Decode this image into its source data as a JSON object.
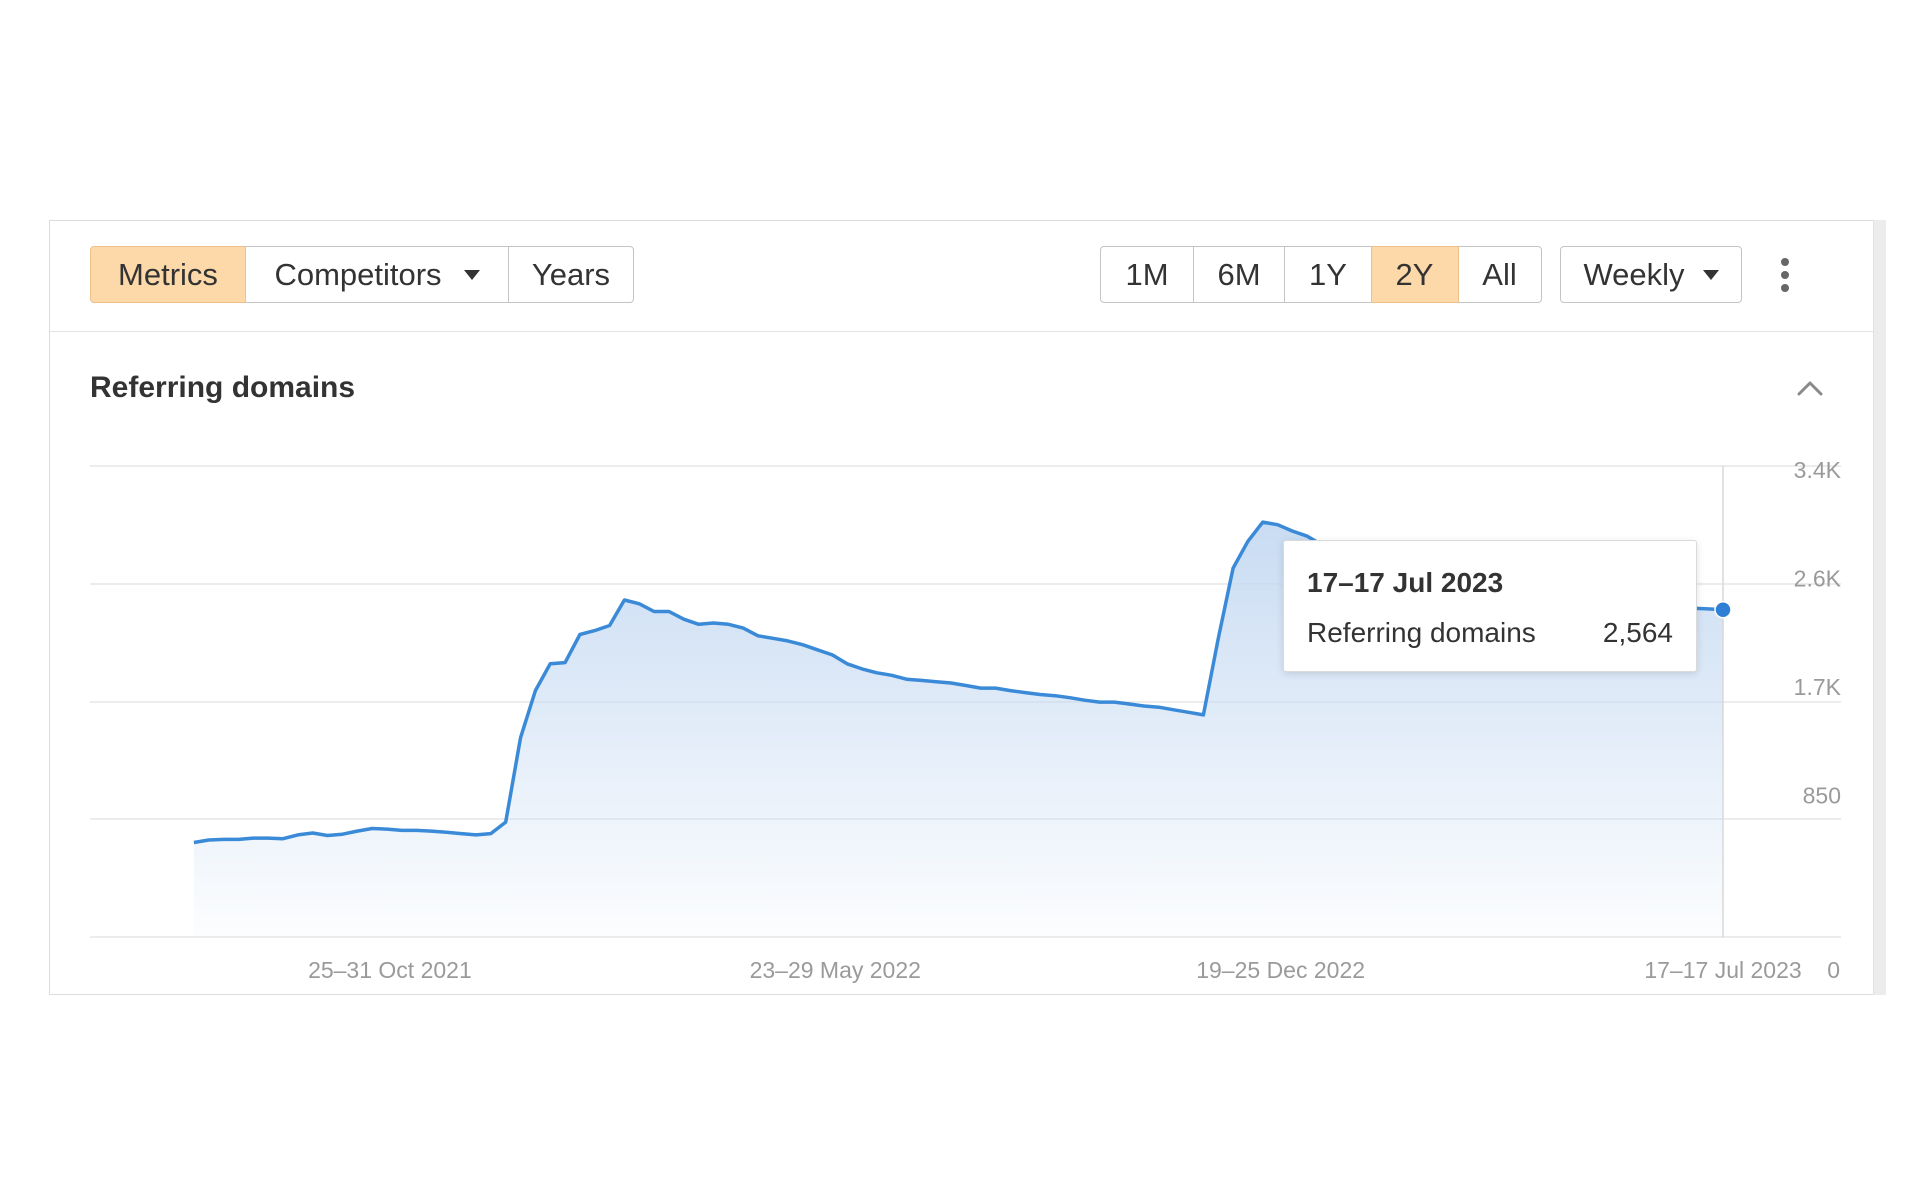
{
  "toolbar": {
    "view_tabs": [
      {
        "label": "Metrics",
        "active": true
      },
      {
        "label": "Competitors",
        "active": false,
        "dropdown": true
      },
      {
        "label": "Years",
        "active": false
      }
    ],
    "range_buttons": [
      {
        "label": "1M",
        "active": false
      },
      {
        "label": "6M",
        "active": false
      },
      {
        "label": "1Y",
        "active": false
      },
      {
        "label": "2Y",
        "active": true
      },
      {
        "label": "All",
        "active": false
      }
    ],
    "interval_select": "Weekly",
    "more_icon": "kebab-vertical-icon"
  },
  "section": {
    "title": "Referring domains",
    "collapse_icon": "chevron-up-icon"
  },
  "colors": {
    "active_button": "#fdd8a8",
    "line": "#3a8ad8",
    "area": "#cfe1f5"
  },
  "chart_data": {
    "type": "area",
    "x_start": "2021-07-26",
    "x_end": "2023-07-17",
    "y_ticks": [
      "0",
      "850",
      "1.7K",
      "2.6K",
      "3.4K"
    ],
    "ylim": [
      0,
      3400
    ],
    "x_tick_labels": [
      "25–31 Oct 2021",
      "23–29 May 2022",
      "19–25 Dec 2022",
      "17–17 Jul 2023"
    ],
    "grid": true,
    "series": [
      {
        "values": [
          [
            "2021-07-26",
            740
          ],
          [
            "2021-08-02",
            760
          ],
          [
            "2021-08-09",
            765
          ],
          [
            "2021-08-16",
            765
          ],
          [
            "2021-08-23",
            775
          ],
          [
            "2021-08-30",
            775
          ],
          [
            "2021-09-06",
            770
          ],
          [
            "2021-09-13",
            800
          ],
          [
            "2021-09-20",
            815
          ],
          [
            "2021-09-27",
            795
          ],
          [
            "2021-10-04",
            805
          ],
          [
            "2021-10-11",
            830
          ],
          [
            "2021-10-18",
            850
          ],
          [
            "2021-10-25",
            845
          ],
          [
            "2021-11-01",
            835
          ],
          [
            "2021-11-08",
            835
          ],
          [
            "2021-11-15",
            830
          ],
          [
            "2021-11-22",
            820
          ],
          [
            "2021-11-29",
            810
          ],
          [
            "2021-12-06",
            800
          ],
          [
            "2021-12-13",
            810
          ],
          [
            "2021-12-20",
            900
          ],
          [
            "2021-12-27",
            1560
          ],
          [
            "2022-01-03",
            1930
          ],
          [
            "2022-01-10",
            2140
          ],
          [
            "2022-01-17",
            2150
          ],
          [
            "2022-01-24",
            2370
          ],
          [
            "2022-01-31",
            2400
          ],
          [
            "2022-02-07",
            2440
          ],
          [
            "2022-02-14",
            2640
          ],
          [
            "2022-02-21",
            2610
          ],
          [
            "2022-02-28",
            2550
          ],
          [
            "2022-03-07",
            2550
          ],
          [
            "2022-03-14",
            2490
          ],
          [
            "2022-03-21",
            2450
          ],
          [
            "2022-03-28",
            2460
          ],
          [
            "2022-04-04",
            2450
          ],
          [
            "2022-04-11",
            2420
          ],
          [
            "2022-04-18",
            2360
          ],
          [
            "2022-04-25",
            2340
          ],
          [
            "2022-05-02",
            2320
          ],
          [
            "2022-05-09",
            2290
          ],
          [
            "2022-05-16",
            2250
          ],
          [
            "2022-05-23",
            2210
          ],
          [
            "2022-05-30",
            2140
          ],
          [
            "2022-06-06",
            2100
          ],
          [
            "2022-06-13",
            2070
          ],
          [
            "2022-06-20",
            2050
          ],
          [
            "2022-06-27",
            2020
          ],
          [
            "2022-07-04",
            2010
          ],
          [
            "2022-07-11",
            2000
          ],
          [
            "2022-07-18",
            1990
          ],
          [
            "2022-07-25",
            1970
          ],
          [
            "2022-08-01",
            1950
          ],
          [
            "2022-08-08",
            1950
          ],
          [
            "2022-08-15",
            1930
          ],
          [
            "2022-08-22",
            1915
          ],
          [
            "2022-08-29",
            1900
          ],
          [
            "2022-09-05",
            1890
          ],
          [
            "2022-09-12",
            1875
          ],
          [
            "2022-09-19",
            1855
          ],
          [
            "2022-09-26",
            1840
          ],
          [
            "2022-10-03",
            1840
          ],
          [
            "2022-10-10",
            1825
          ],
          [
            "2022-10-17",
            1810
          ],
          [
            "2022-10-24",
            1800
          ],
          [
            "2022-10-31",
            1780
          ],
          [
            "2022-11-07",
            1760
          ],
          [
            "2022-11-14",
            1740
          ],
          [
            "2022-11-21",
            2340
          ],
          [
            "2022-11-28",
            2890
          ],
          [
            "2022-12-05",
            3100
          ],
          [
            "2022-12-12",
            3250
          ],
          [
            "2022-12-19",
            3230
          ],
          [
            "2022-12-26",
            3180
          ],
          [
            "2023-01-02",
            3140
          ],
          [
            "2023-01-09",
            3070
          ],
          [
            "2023-01-16",
            3020
          ],
          [
            "2023-01-23",
            3000
          ],
          [
            "2023-01-30",
            2960
          ],
          [
            "2023-02-06",
            2920
          ],
          [
            "2023-02-13",
            2890
          ],
          [
            "2023-02-20",
            2880
          ],
          [
            "2023-02-27",
            2860
          ],
          [
            "2023-03-06",
            2830
          ],
          [
            "2023-03-13",
            2810
          ],
          [
            "2023-03-20",
            2780
          ],
          [
            "2023-03-27",
            2760
          ],
          [
            "2023-04-03",
            2740
          ],
          [
            "2023-04-10",
            2720
          ],
          [
            "2023-04-17",
            2700
          ],
          [
            "2023-04-24",
            2690
          ],
          [
            "2023-05-01",
            2670
          ],
          [
            "2023-05-08",
            2650
          ],
          [
            "2023-05-15",
            2640
          ],
          [
            "2023-05-22",
            2620
          ],
          [
            "2023-05-29",
            2610
          ],
          [
            "2023-06-05",
            2600
          ],
          [
            "2023-06-12",
            2590
          ],
          [
            "2023-06-19",
            2585
          ],
          [
            "2023-06-26",
            2580
          ],
          [
            "2023-07-03",
            2575
          ],
          [
            "2023-07-10",
            2570
          ],
          [
            "2023-07-17",
            2564
          ]
        ]
      }
    ]
  },
  "tooltip": {
    "date": "17–17 Jul 2023",
    "metric": "Referring domains",
    "value": "2,564"
  }
}
